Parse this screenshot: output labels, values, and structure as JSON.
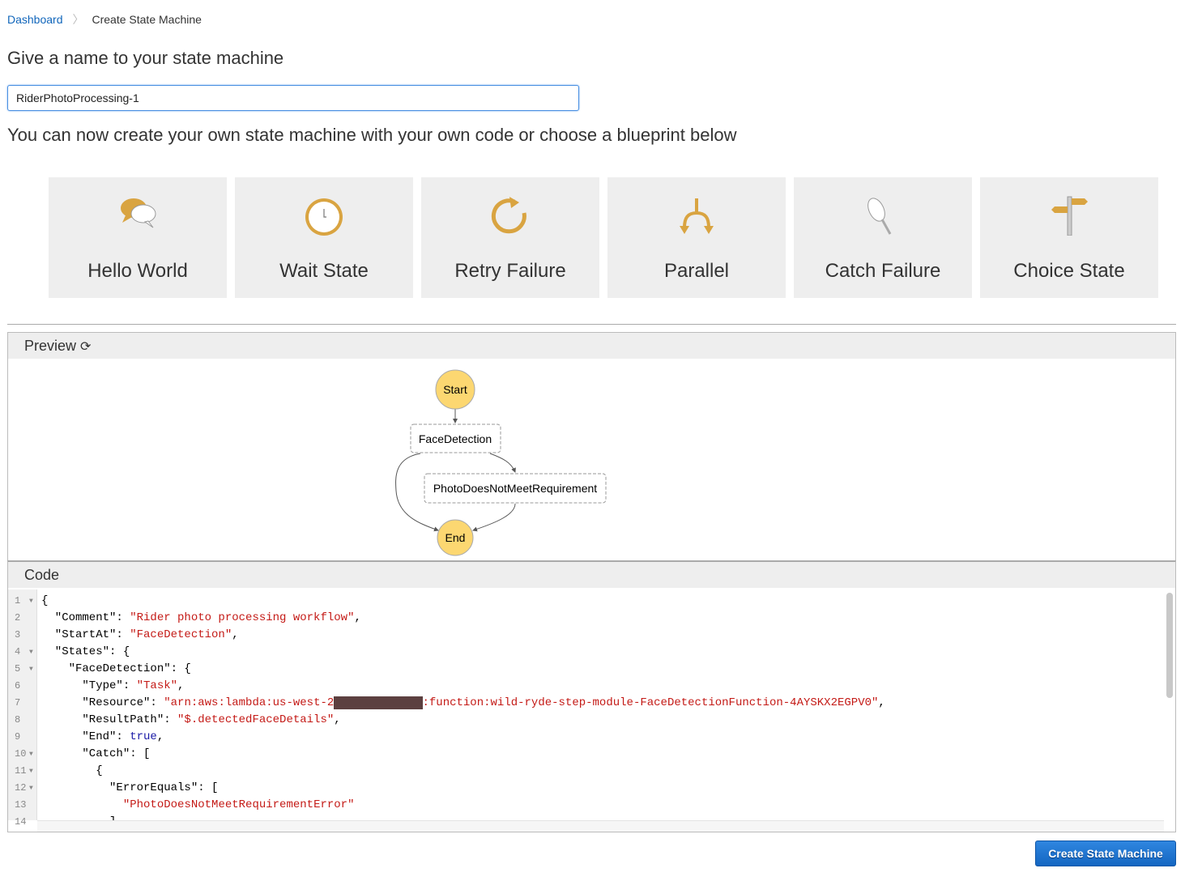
{
  "breadcrumb": {
    "items": [
      "Dashboard",
      "Create State Machine"
    ]
  },
  "page_title": "Give a name to your state machine",
  "name_input": {
    "value": "RiderPhotoProcessing-1"
  },
  "subtitle": "You can now create your own state machine with your own code or choose a blueprint below",
  "blueprints": [
    {
      "label": "Hello World",
      "icon": "speech-bubbles-icon"
    },
    {
      "label": "Wait State",
      "icon": "clock-icon"
    },
    {
      "label": "Retry Failure",
      "icon": "retry-arrow-icon"
    },
    {
      "label": "Parallel",
      "icon": "split-arrows-icon"
    },
    {
      "label": "Catch Failure",
      "icon": "net-icon"
    },
    {
      "label": "Choice State",
      "icon": "signpost-icon"
    }
  ],
  "accent_color": "#d9a441",
  "preview": {
    "title": "Preview",
    "refresh_icon": "refresh-icon",
    "graph": {
      "start": "Start",
      "end": "End",
      "states": [
        "FaceDetection",
        "PhotoDoesNotMeetRequirement"
      ]
    }
  },
  "code": {
    "title": "Code",
    "lines": [
      {
        "n": "1",
        "fold": true,
        "t": [
          [
            "",
            "{"
          ]
        ]
      },
      {
        "n": "2",
        "t": [
          [
            "",
            "  \"Comment\": "
          ],
          [
            "s",
            "\"Rider photo processing workflow\""
          ],
          [
            "",
            ","
          ]
        ]
      },
      {
        "n": "3",
        "t": [
          [
            "",
            "  \"StartAt\": "
          ],
          [
            "s",
            "\"FaceDetection\""
          ],
          [
            "",
            ","
          ]
        ]
      },
      {
        "n": "4",
        "fold": true,
        "t": [
          [
            "",
            "  \"States\": {"
          ]
        ]
      },
      {
        "n": "5",
        "fold": true,
        "t": [
          [
            "",
            "    \"FaceDetection\": {"
          ]
        ]
      },
      {
        "n": "6",
        "t": [
          [
            "",
            "      \"Type\": "
          ],
          [
            "s",
            "\"Task\""
          ],
          [
            "",
            ","
          ]
        ]
      },
      {
        "n": "7",
        "t": [
          [
            "",
            "      \"Resource\": "
          ],
          [
            "s",
            "\"arn:aws:lambda:us-west-2"
          ],
          [
            "r",
            ":XXXXXXXXXXXX"
          ],
          [
            "s",
            ":function:wild-ryde-step-module-FaceDetectionFunction-4AYSKX2EGPV0\""
          ],
          [
            "",
            ","
          ]
        ]
      },
      {
        "n": "8",
        "t": [
          [
            "",
            "      \"ResultPath\": "
          ],
          [
            "s",
            "\"$.detectedFaceDetails\""
          ],
          [
            "",
            ","
          ]
        ]
      },
      {
        "n": "9",
        "t": [
          [
            "",
            "      \"End\": "
          ],
          [
            "b",
            "true"
          ],
          [
            "",
            ","
          ]
        ]
      },
      {
        "n": "10",
        "fold": true,
        "t": [
          [
            "",
            "      \"Catch\": ["
          ]
        ]
      },
      {
        "n": "11",
        "fold": true,
        "t": [
          [
            "",
            "        {"
          ]
        ]
      },
      {
        "n": "12",
        "fold": true,
        "t": [
          [
            "",
            "          \"ErrorEquals\": ["
          ]
        ]
      },
      {
        "n": "13",
        "t": [
          [
            "",
            "            "
          ],
          [
            "s",
            "\"PhotoDoesNotMeetRequirementError\""
          ]
        ]
      },
      {
        "n": "14",
        "t": [
          [
            "",
            "          ]"
          ]
        ]
      }
    ]
  },
  "create_button": "Create State Machine"
}
